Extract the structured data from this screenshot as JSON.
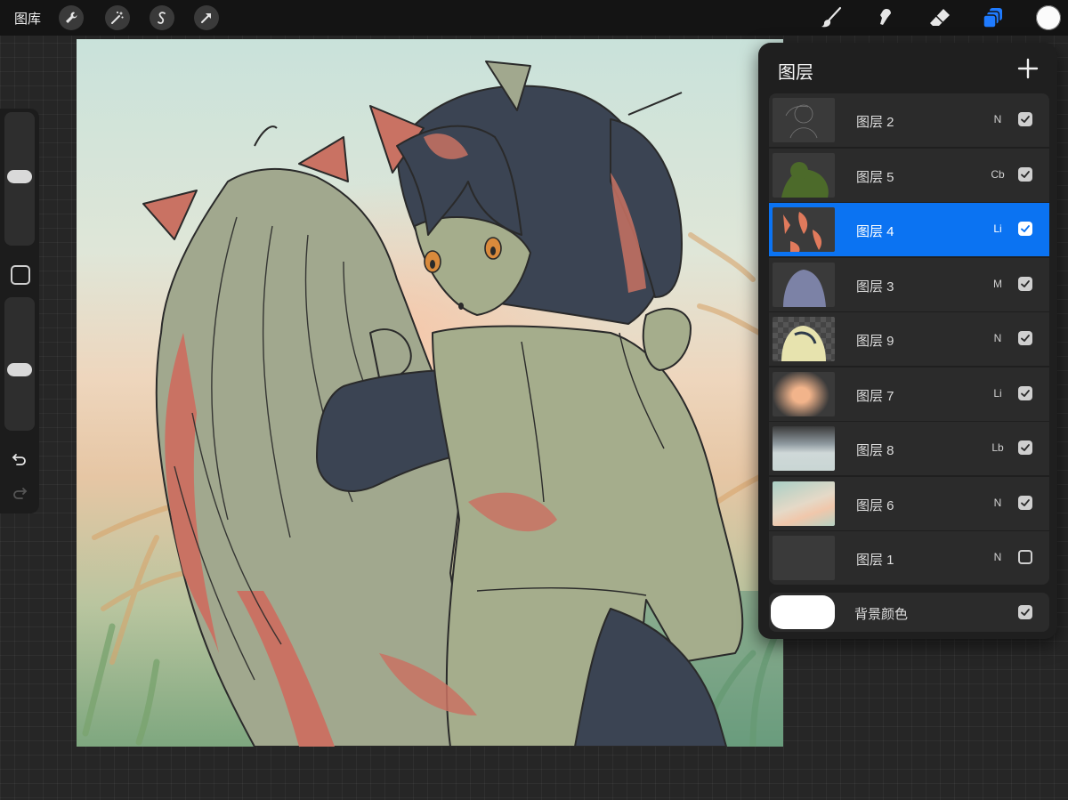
{
  "toolbar": {
    "gallery_label": "图库",
    "left_icons": [
      "wrench-icon",
      "magic-wand-icon",
      "selection-icon",
      "transform-arrow-icon"
    ],
    "right_icons": [
      "brush-icon",
      "smudge-icon",
      "eraser-icon",
      "layers-icon"
    ],
    "active_tool_color": "#1f7bff",
    "current_color": "#fbfbfb"
  },
  "sidebar": {
    "brush_size": 0.52,
    "opacity": 0.45
  },
  "layers_panel": {
    "title": "图层",
    "layers": [
      {
        "name": "图层 2",
        "mode": "N",
        "visible": true,
        "active": false
      },
      {
        "name": "图层 5",
        "mode": "Cb",
        "visible": true,
        "active": false
      },
      {
        "name": "图层 4",
        "mode": "Li",
        "visible": true,
        "active": true
      },
      {
        "name": "图层 3",
        "mode": "M",
        "visible": true,
        "active": false
      },
      {
        "name": "图层 9",
        "mode": "N",
        "visible": true,
        "active": false
      },
      {
        "name": "图层 7",
        "mode": "Li",
        "visible": true,
        "active": false
      },
      {
        "name": "图层 8",
        "mode": "Lb",
        "visible": true,
        "active": false
      },
      {
        "name": "图层 6",
        "mode": "N",
        "visible": true,
        "active": false
      },
      {
        "name": "图层 1",
        "mode": "N",
        "visible": false,
        "active": false
      }
    ],
    "background": {
      "label": "背景颜色",
      "color": "#ffffff",
      "visible": true
    }
  }
}
